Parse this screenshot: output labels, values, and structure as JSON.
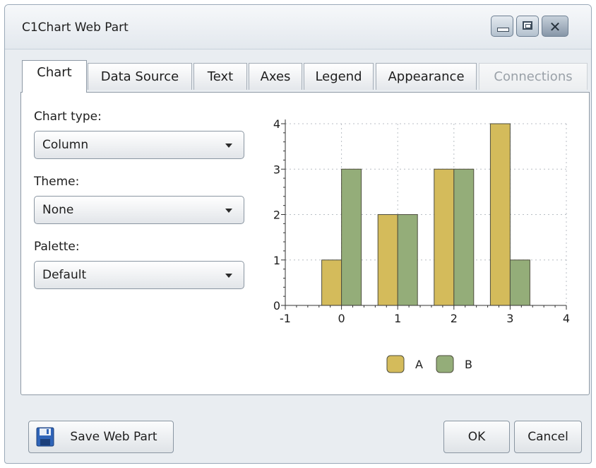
{
  "window": {
    "title": "C1Chart Web Part"
  },
  "tabs": [
    {
      "label": "Chart",
      "state": "active"
    },
    {
      "label": "Data Source",
      "state": "normal"
    },
    {
      "label": "Text",
      "state": "normal"
    },
    {
      "label": "Axes",
      "state": "normal"
    },
    {
      "label": "Legend",
      "state": "normal"
    },
    {
      "label": "Appearance",
      "state": "normal"
    },
    {
      "label": "Connections",
      "state": "disabled"
    }
  ],
  "form": {
    "chart_type": {
      "label": "Chart type:",
      "value": "Column"
    },
    "theme": {
      "label": "Theme:",
      "value": "None"
    },
    "palette": {
      "label": "Palette:",
      "value": "Default"
    }
  },
  "chart_data": {
    "type": "bar",
    "x": [
      0,
      1,
      2,
      3
    ],
    "series": [
      {
        "name": "A",
        "values": [
          1,
          2,
          3,
          4
        ],
        "color": "#d4bb5b"
      },
      {
        "name": "B",
        "values": [
          3,
          2,
          3,
          1
        ],
        "color": "#94ad79"
      }
    ],
    "xlim": [
      -1,
      4
    ],
    "ylim": [
      0,
      4
    ],
    "xticks": [
      "-1",
      "0",
      "1",
      "2",
      "3",
      "4"
    ],
    "yticks": [
      "0",
      "1",
      "2",
      "3",
      "4"
    ],
    "grid": true,
    "legend_position": "bottom"
  },
  "footer": {
    "save_label": "Save Web Part",
    "ok_label": "OK",
    "cancel_label": "Cancel"
  }
}
